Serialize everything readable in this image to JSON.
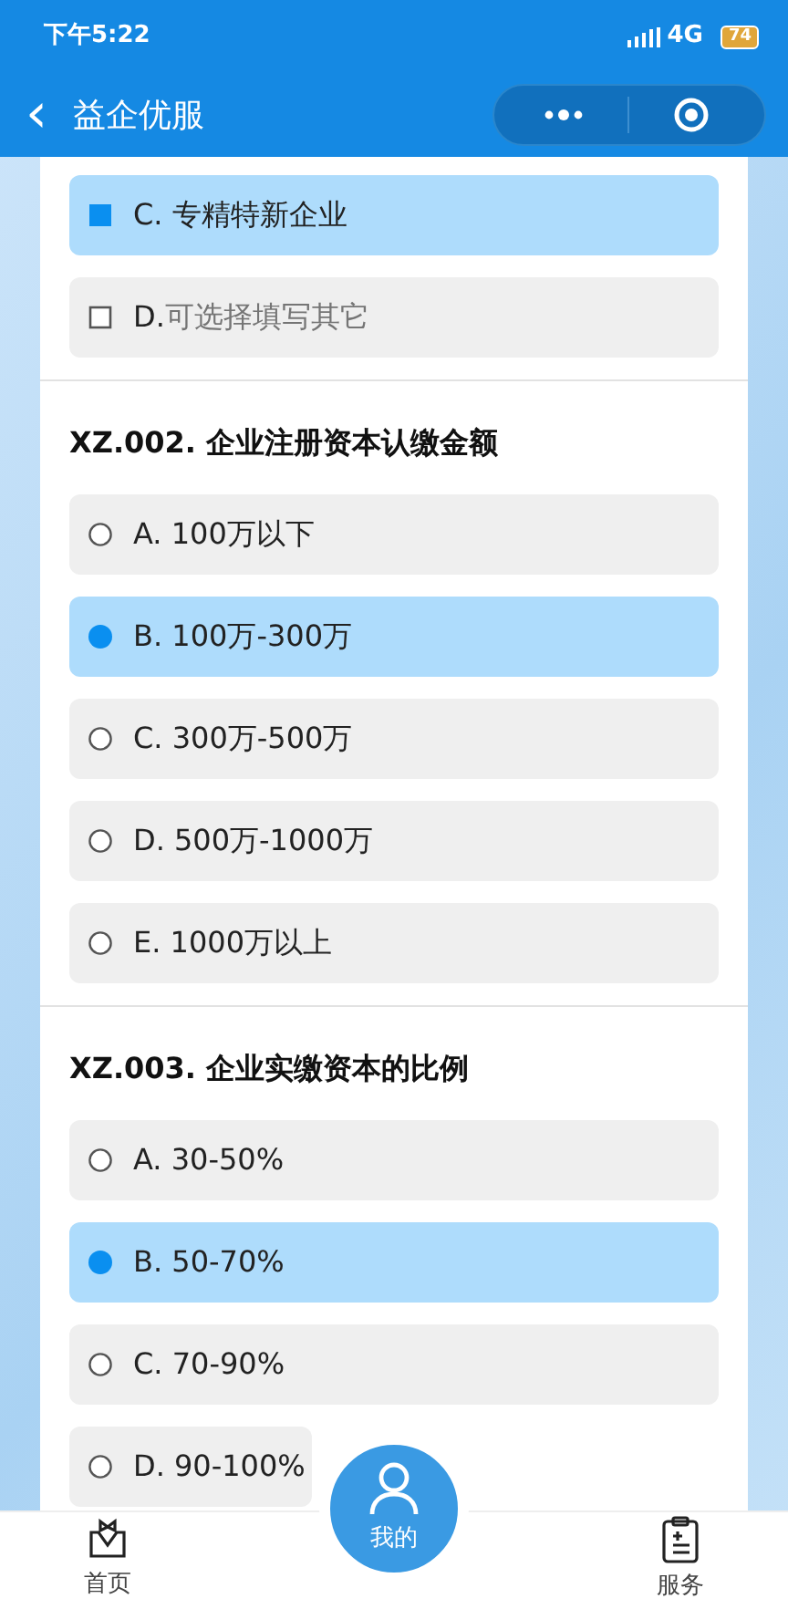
{
  "status_bar": {
    "time": "下午5:22",
    "network": "4G",
    "battery": "74"
  },
  "nav": {
    "back": "‹",
    "title": "益企优服"
  },
  "questions": [
    {
      "options": [
        {
          "kind": "checkbox",
          "label": "C. 专精特新企业",
          "selected": true
        },
        {
          "kind": "other",
          "label": "D.",
          "placeholder": "可选择填写其它",
          "selected": false
        }
      ]
    },
    {
      "title": "XZ.002. 企业注册资本认缴金额",
      "options": [
        {
          "kind": "radio",
          "label": "A. 100万以下",
          "selected": false
        },
        {
          "kind": "radio",
          "label": "B. 100万-300万",
          "selected": true
        },
        {
          "kind": "radio",
          "label": "C. 300万-500万",
          "selected": false
        },
        {
          "kind": "radio",
          "label": "D. 500万-1000万",
          "selected": false
        },
        {
          "kind": "radio",
          "label": "E. 1000万以上",
          "selected": false
        }
      ]
    },
    {
      "title": "XZ.003. 企业实缴资本的比例",
      "options": [
        {
          "kind": "radio",
          "label": "A. 30-50%",
          "selected": false
        },
        {
          "kind": "radio",
          "label": "B. 50-70%",
          "selected": true
        },
        {
          "kind": "radio",
          "label": "C. 70-90%",
          "selected": false
        },
        {
          "kind": "radio",
          "label": "D. 90-100%",
          "selected": false
        }
      ]
    }
  ],
  "tab_bar": [
    {
      "kind": "home",
      "label": "首页",
      "selected": false
    },
    {
      "kind": "profile",
      "label": "我的",
      "selected": true
    },
    {
      "kind": "service",
      "label": "服务",
      "selected": false
    }
  ]
}
